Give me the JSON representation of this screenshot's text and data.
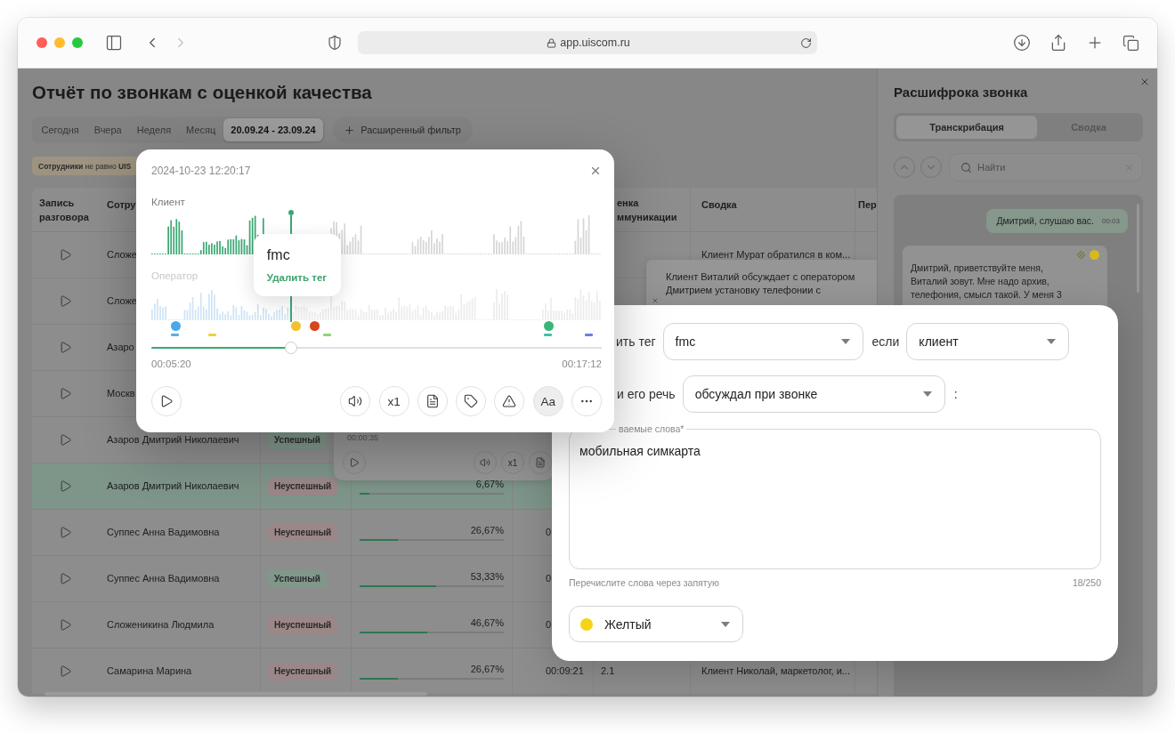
{
  "browser": {
    "address": "app.uiscom.ru"
  },
  "report": {
    "title": "Отчёт по звонкам с оценкой качества",
    "periods": [
      {
        "label": "Сегодня",
        "selected": false
      },
      {
        "label": "Вчера",
        "selected": false
      },
      {
        "label": "Неделя",
        "selected": false
      },
      {
        "label": "Месяц",
        "selected": false
      },
      {
        "label": "20.09.24 - 23.09.24",
        "selected": true
      }
    ],
    "filter_button": "Расширенный фильтр",
    "filter_chip": "**Сотрудники** не равно **UIS**",
    "table": {
      "columns": {
        "recording": "Запись разговора",
        "employee": "Сотру",
        "rating": "енка ммуникации",
        "summary": "Сводка",
        "column_8": "Пер"
      },
      "rows": [
        {
          "selected": false,
          "employee": "Сложе",
          "summary": "Клиент Мурат обратился в ком..."
        },
        {
          "selected": false,
          "employee": "Сложе"
        },
        {
          "selected": false,
          "employee": "Азаро"
        },
        {
          "selected": false,
          "employee": "Москв"
        },
        {
          "selected": false,
          "employee": "Азаров Дмитрий Николаевич",
          "status": {
            "label": "Успешный",
            "kind": "success"
          }
        },
        {
          "selected": true,
          "employee": "Азаров Дмитрий Николаевич",
          "status": {
            "label": "Неуспешный",
            "kind": "fail"
          },
          "score": {
            "text": "6,67%",
            "level": 0.0667
          }
        },
        {
          "selected": false,
          "employee": "Суппес Анна Вадимовна",
          "status": {
            "label": "Неуспешный",
            "kind": "fail"
          },
          "score": {
            "text": "26,67%",
            "level": 0.2667
          },
          "duration": "0"
        },
        {
          "selected": false,
          "employee": "Суппес Анна Вадимовна",
          "status": {
            "label": "Успешный",
            "kind": "success"
          },
          "score": {
            "text": "53,33%",
            "level": 0.5333
          },
          "duration": "0"
        },
        {
          "selected": false,
          "employee": "Сложеникина Людмила",
          "status": {
            "label": "Неуспешный",
            "kind": "fail"
          },
          "score": {
            "text": "46,67%",
            "level": 0.4667
          },
          "duration": "0"
        },
        {
          "selected": false,
          "employee": "Самарина Марина",
          "status": {
            "label": "Неуспешный",
            "kind": "fail"
          },
          "score": {
            "text": "26,67%",
            "level": 0.2667
          },
          "duration": "00:09:21",
          "rating": "2.1",
          "summary": "Клиент Николай, маркетолог, и..."
        }
      ],
      "summary_popover": "Клиент Виталий обсуждает с оператором Дмитрием установку телефонии с",
      "mini_player": {
        "time": "00:00:35",
        "controls": [
          {
            "kind": "speaker"
          },
          {
            "kind": "speed",
            "label": "x1"
          },
          {
            "kind": "transcript"
          }
        ]
      }
    }
  },
  "transcript": {
    "title": "Расшифрока звонка",
    "tabs": [
      {
        "label": "Транскрибация",
        "selected": true
      },
      {
        "label": "Сводка",
        "selected": false
      }
    ],
    "navigation": {
      "disabled": true
    },
    "search": {
      "placeholder": "Найти"
    },
    "messages": [
      {
        "kind": "operator",
        "text": "Дмитрий, слушаю вас.",
        "time": "00:03"
      },
      {
        "kind": "client",
        "text": "Дмитрий, приветствуйте меня, Виталий зовут. Мне надо архив, телефония, смысл такой. У меня 3",
        "color": "#d8b820"
      }
    ]
  },
  "player": {
    "date": "2024-10-23 12:20:17",
    "channels": [
      {
        "label": "Клиент",
        "active": true
      },
      {
        "label": "Оператор",
        "active": false
      }
    ],
    "tooltip": {
      "tag": "fmc",
      "action": "Удалить тег"
    },
    "marks": [
      {
        "kind": "dot",
        "color": "#4aa8ea",
        "level": 0.055
      },
      {
        "kind": "dash",
        "color": "#5aaeea",
        "level": 0.052
      },
      {
        "kind": "dash",
        "color": "#f0cf3a",
        "level": 0.135
      },
      {
        "kind": "dot",
        "color": "#f2c12e",
        "level": 0.322
      },
      {
        "kind": "dot",
        "color": "#d8461b",
        "level": 0.362
      },
      {
        "kind": "dash",
        "color": "#8fd66a",
        "level": 0.391
      },
      {
        "kind": "dot",
        "color": "#3bb57a",
        "level": 0.883
      },
      {
        "kind": "dash",
        "color": "#3fc0b0",
        "level": 0.881
      },
      {
        "kind": "dash",
        "color": "#6b7fe0",
        "level": 0.971
      }
    ],
    "level": 0.31,
    "elapsed": "00:05:20",
    "total": "00:17:12",
    "controls": [
      {
        "kind": "speaker",
        "on": false
      },
      {
        "kind": "speed",
        "label": "x1",
        "on": false
      },
      {
        "kind": "transcript",
        "on": false
      },
      {
        "kind": "tag",
        "on": false
      },
      {
        "kind": "warning",
        "on": false
      },
      {
        "kind": "font",
        "label": "Aa",
        "on": true
      },
      {
        "kind": "more",
        "on": false
      }
    ]
  },
  "tag_rule": {
    "tag_label": "ить тег",
    "tag": "fmc",
    "if_label": "если",
    "speaker": "клиент",
    "speech_label": "и его речь",
    "condition": "обсуждал при звонке",
    "colon": ":",
    "keywords": {
      "label": "ваемые слова*",
      "value": "мобильная симкарта",
      "hint": "Перечислите слова через запятую",
      "counter": "18/250"
    },
    "color": {
      "label": "Желтый",
      "color": "#f5d31a"
    }
  }
}
